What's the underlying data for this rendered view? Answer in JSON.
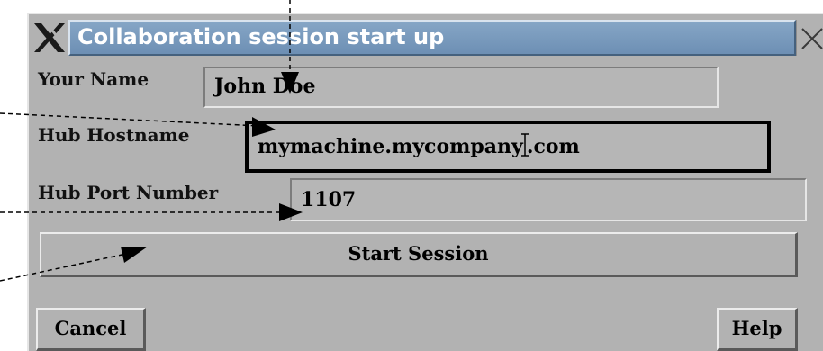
{
  "window": {
    "title": "Collaboration session start up"
  },
  "form": {
    "name_label": "Your Name",
    "name_value": "John Doe",
    "hostname_label": "Hub Hostname",
    "hostname_value_before_cursor": "mymachine.mycompany",
    "hostname_value_after_cursor": ".com",
    "port_label": "Hub Port Number",
    "port_value": "1107"
  },
  "buttons": {
    "start": "Start Session",
    "cancel": "Cancel",
    "help": "Help"
  },
  "colors": {
    "dialog_bg": "#b2b2b2",
    "titlebar_bg": "#7a9abd",
    "title_text": "#ffffff"
  },
  "icons": [
    "x-logo-icon",
    "close-icon",
    "text-cursor-icon",
    "arrow-icon"
  ]
}
